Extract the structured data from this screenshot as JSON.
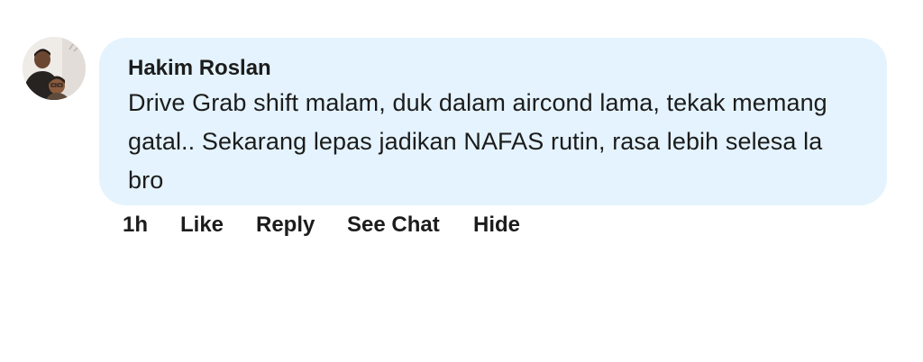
{
  "comment": {
    "author": "Hakim Roslan",
    "text": "Drive Grab shift malam, duk dalam aircond lama, tekak memang gatal.. Sekarang lepas jadikan NAFAS rutin, rasa lebih selesa la bro",
    "timestamp": "1h",
    "actions": {
      "like": "Like",
      "reply": "Reply",
      "see_chat": "See Chat",
      "hide": "Hide"
    },
    "avatar_icon": "user-photo-avatar"
  },
  "colors": {
    "bubble_background": "#e4f3fd",
    "text": "#1c1c1c",
    "page_background": "#ffffff"
  }
}
